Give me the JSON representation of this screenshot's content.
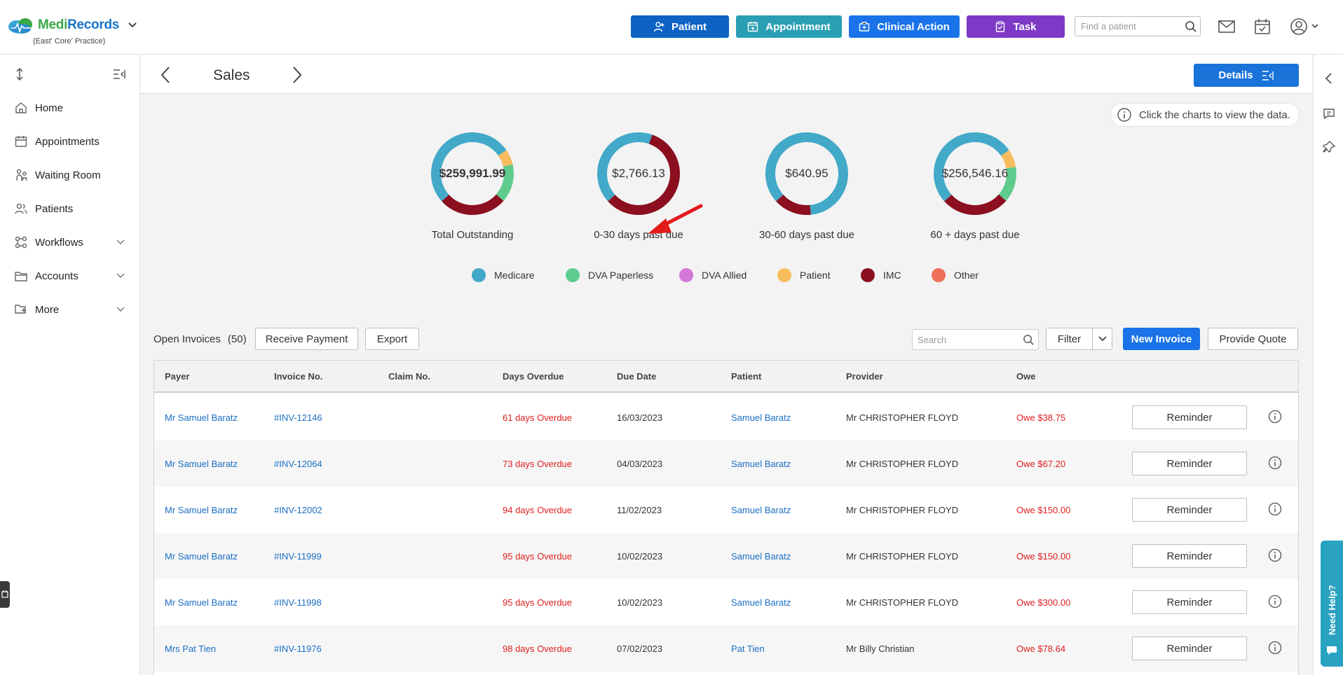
{
  "app": {
    "logo_part1": "Medi",
    "logo_part2": "Records",
    "practice": "(East' Core' Practice)"
  },
  "topbar": {
    "buttons": [
      {
        "label": "Patient",
        "color": "#0d62c4"
      },
      {
        "label": "Appointment",
        "color": "#2a9fb4"
      },
      {
        "label": "Clinical Action",
        "color": "#1a73e8"
      },
      {
        "label": "Task",
        "color": "#7e3ac6"
      }
    ],
    "find_placeholder": "Find a patient"
  },
  "sidebar": {
    "items": [
      {
        "label": "Home",
        "icon": "home-icon"
      },
      {
        "label": "Appointments",
        "icon": "calendar-icon"
      },
      {
        "label": "Waiting Room",
        "icon": "waiting-room-icon"
      },
      {
        "label": "Patients",
        "icon": "patients-icon"
      },
      {
        "label": "Workflows",
        "icon": "workflow-icon",
        "expandable": true
      },
      {
        "label": "Accounts",
        "icon": "folder-icon",
        "expandable": true
      },
      {
        "label": "More",
        "icon": "folder-tree-icon",
        "expandable": true
      }
    ]
  },
  "header": {
    "title": "Sales",
    "details_label": "Details"
  },
  "hint": "Click the charts to view the data.",
  "charts": [
    {
      "amount": "$259,991.99",
      "label": "Total Outstanding",
      "bold": true,
      "segments": [
        {
          "name": "Medicare",
          "value": 0.52
        },
        {
          "name": "Patient",
          "value": 0.06
        },
        {
          "name": "DVA Paperless",
          "value": 0.15
        },
        {
          "name": "IMC",
          "value": 0.27
        }
      ]
    },
    {
      "amount": "$2,766.13",
      "label": "0-30 days past due",
      "bold": false,
      "segments": [
        {
          "name": "Medicare",
          "value": 0.42
        },
        {
          "name": "IMC",
          "value": 0.58
        }
      ]
    },
    {
      "amount": "$640.95",
      "label": "30-60 days past due",
      "bold": false,
      "segments": [
        {
          "name": "Medicare",
          "value": 0.85
        },
        {
          "name": "IMC",
          "value": 0.15
        }
      ]
    },
    {
      "amount": "$256,546.16",
      "label": "60 + days past due",
      "bold": false,
      "segments": [
        {
          "name": "Medicare",
          "value": 0.52
        },
        {
          "name": "Patient",
          "value": 0.07
        },
        {
          "name": "DVA Paperless",
          "value": 0.14
        },
        {
          "name": "IMC",
          "value": 0.27
        }
      ]
    }
  ],
  "legend": [
    {
      "label": "Medicare",
      "color": "#43a9c8"
    },
    {
      "label": "DVA Paperless",
      "color": "#5fcc8e"
    },
    {
      "label": "DVA Allied",
      "color": "#d678d9"
    },
    {
      "label": "Patient",
      "color": "#f7bc5e"
    },
    {
      "label": "IMC",
      "color": "#8b0f1f"
    },
    {
      "label": "Other",
      "color": "#f0705c"
    }
  ],
  "toolbar": {
    "open_invoices_label": "Open Invoices",
    "open_invoices_count": "(50)",
    "receive_payment": "Receive Payment",
    "export": "Export",
    "search_placeholder": "Search",
    "filter": "Filter",
    "new_invoice": "New Invoice",
    "provide_quote": "Provide Quote"
  },
  "table": {
    "headers": [
      "Payer",
      "Invoice No.",
      "Claim No.",
      "Days Overdue",
      "Due Date",
      "Patient",
      "Provider",
      "Owe"
    ],
    "reminder_label": "Reminder",
    "rows": [
      {
        "payer": "Mr Samuel Baratz",
        "invoice": "#INV-12146",
        "claim": "",
        "overdue": "61 days Overdue",
        "due": "16/03/2023",
        "patient": "Samuel Baratz",
        "provider": "Mr CHRISTOPHER FLOYD",
        "owe": "Owe $38.75"
      },
      {
        "payer": "Mr Samuel Baratz",
        "invoice": "#INV-12064",
        "claim": "",
        "overdue": "73 days Overdue",
        "due": "04/03/2023",
        "patient": "Samuel Baratz",
        "provider": "Mr CHRISTOPHER FLOYD",
        "owe": "Owe $67.20"
      },
      {
        "payer": "Mr Samuel Baratz",
        "invoice": "#INV-12002",
        "claim": "",
        "overdue": "94 days Overdue",
        "due": "11/02/2023",
        "patient": "Samuel Baratz",
        "provider": "Mr CHRISTOPHER FLOYD",
        "owe": "Owe $150.00"
      },
      {
        "payer": "Mr Samuel Baratz",
        "invoice": "#INV-11999",
        "claim": "",
        "overdue": "95 days Overdue",
        "due": "10/02/2023",
        "patient": "Samuel Baratz",
        "provider": "Mr CHRISTOPHER FLOYD",
        "owe": "Owe $150.00"
      },
      {
        "payer": "Mr Samuel Baratz",
        "invoice": "#INV-11998",
        "claim": "",
        "overdue": "95 days Overdue",
        "due": "10/02/2023",
        "patient": "Samuel Baratz",
        "provider": "Mr CHRISTOPHER FLOYD",
        "owe": "Owe $300.00"
      },
      {
        "payer": "Mrs Pat Tien",
        "invoice": "#INV-11976",
        "claim": "",
        "overdue": "98 days Overdue",
        "due": "07/02/2023",
        "patient": "Pat Tien",
        "provider": "Mr Billy Christian",
        "owe": "Owe $78.64"
      }
    ]
  },
  "help": {
    "label": "Need Help?"
  }
}
